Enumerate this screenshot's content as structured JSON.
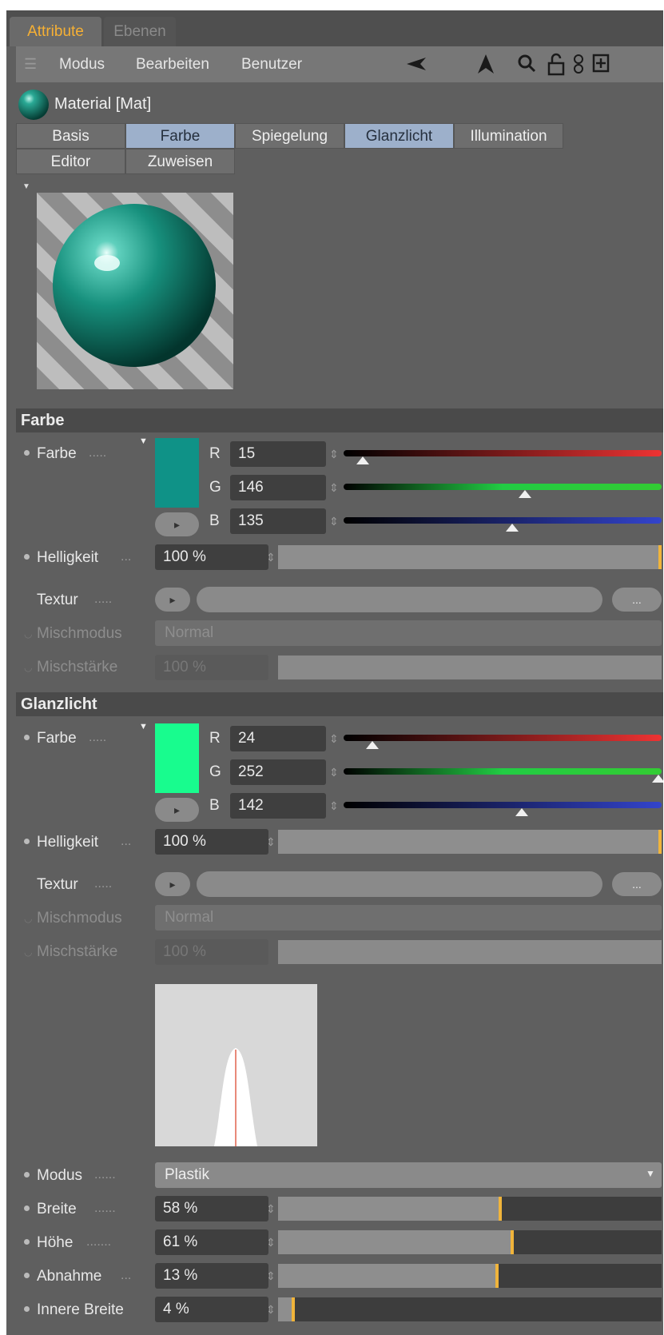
{
  "tabs": {
    "attribute": "Attribute",
    "ebenen": "Ebenen"
  },
  "toolbar": {
    "modus": "Modus",
    "bearbeiten": "Bearbeiten",
    "benutzer": "Benutzer"
  },
  "material": {
    "name": "Material [Mat]"
  },
  "channel_tabs": {
    "row1": [
      "Basis",
      "Farbe",
      "Spiegelung",
      "Glanzlicht",
      "Illumination"
    ],
    "row2": [
      "Editor",
      "Zuweisen"
    ]
  },
  "farbe_section": {
    "title": "Farbe",
    "farbe_label": "Farbe",
    "color_hex": "#0f9287",
    "r": "15",
    "g": "146",
    "b": "135",
    "r_level": 0.06,
    "g_level": 0.57,
    "b_level": 0.53,
    "helligkeit_label": "Helligkeit",
    "helligkeit": "100 %",
    "helligkeit_level": 1.0,
    "textur_label": "Textur",
    "textur_btn": "...",
    "mischmodus_label": "Mischmodus",
    "mischmodus": "Normal",
    "mischstaerke_label": "Mischstärke",
    "mischstaerke": "100 %"
  },
  "glanz_section": {
    "title": "Glanzlicht",
    "farbe_label": "Farbe",
    "color_hex": "#18fc8e",
    "r": "24",
    "g": "252",
    "b": "142",
    "r_level": 0.09,
    "g_level": 0.99,
    "b_level": 0.56,
    "helligkeit_label": "Helligkeit",
    "helligkeit": "100 %",
    "helligkeit_level": 1.0,
    "textur_label": "Textur",
    "textur_btn": "...",
    "mischmodus_label": "Mischmodus",
    "mischmodus": "Normal",
    "mischstaerke_label": "Mischstärke",
    "mischstaerke": "100 %",
    "modus_label": "Modus",
    "modus": "Plastik",
    "breite_label": "Breite",
    "breite": "58 %",
    "breite_level": 0.58,
    "hoehe_label": "Höhe",
    "hoehe": "61 %",
    "hoehe_level": 0.61,
    "abnahme_label": "Abnahme",
    "abnahme": "13 %",
    "abnahme_level": 0.57,
    "innere_breite_label": "Innere Breite",
    "innere_breite": "4 %",
    "innere_breite_level": 0.04
  }
}
